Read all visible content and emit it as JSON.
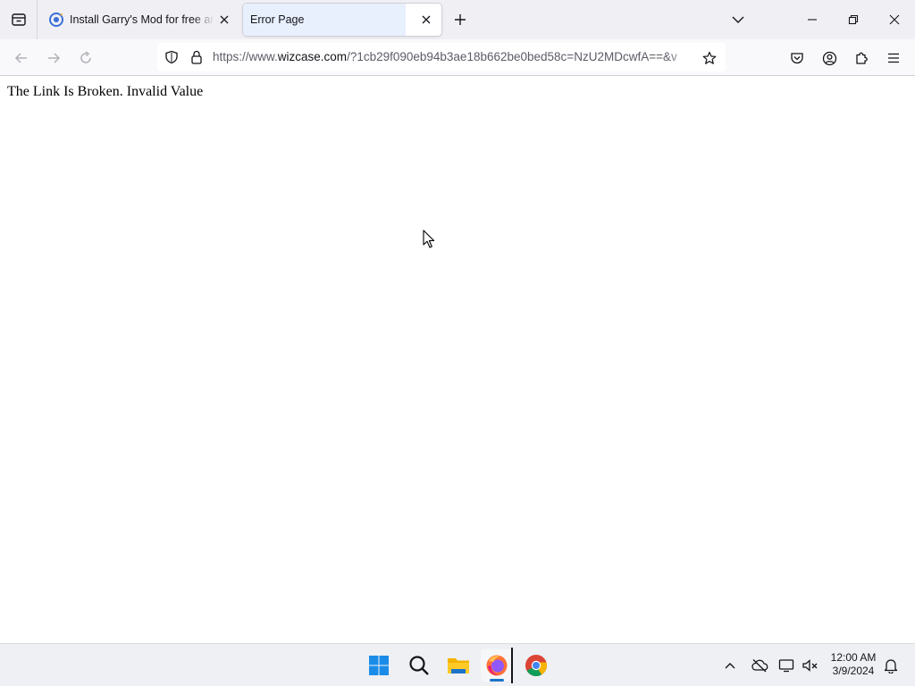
{
  "browser": {
    "tabs": [
      {
        "title": "Install Garry's Mod for free and",
        "active": false,
        "favicon": "wizcase-favicon"
      },
      {
        "title": "Error Page",
        "active": true
      }
    ],
    "url": {
      "prefix": "https://www.",
      "domain": "wizcase.com",
      "path": "/?1cb29f090eb94b3ae18b662be0bed58c=NzU2MDcwfA==&v"
    }
  },
  "page": {
    "message": "The Link Is Broken. Invalid Value"
  },
  "taskbar": {
    "apps": [
      "start-icon",
      "search-icon",
      "file-explorer-icon",
      "firefox-icon",
      "chrome-icon"
    ],
    "clock": {
      "time": "12:00 AM",
      "date": "3/9/2024"
    }
  },
  "colors": {
    "active_tab_highlight": "#e8f0fe",
    "chrome_bg": "#f0f0f4",
    "taskbar_bg": "#eef0f4",
    "accent": "#1a73c8"
  }
}
